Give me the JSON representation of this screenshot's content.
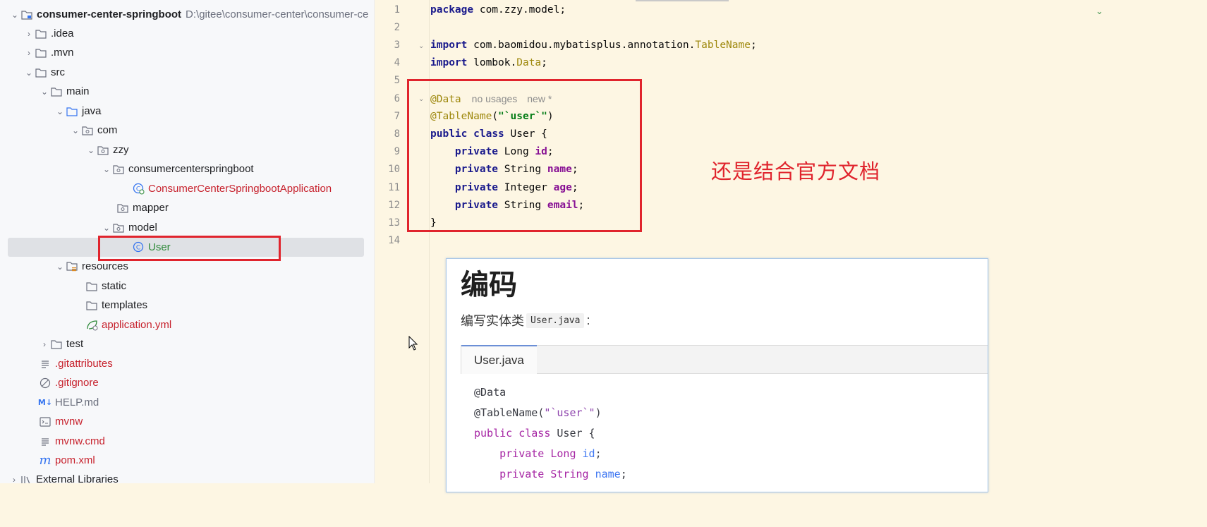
{
  "project_tree": {
    "root": {
      "name": "consumer-center-springboot",
      "path": "D:\\gitee\\consumer-center\\consumer-ce"
    },
    "items": [
      {
        "label": ".idea",
        "icon": "folder-icon"
      },
      {
        "label": ".mvn",
        "icon": "folder-icon"
      },
      {
        "label": "src",
        "icon": "folder-icon"
      },
      {
        "label": "main",
        "icon": "folder-icon"
      },
      {
        "label": "java",
        "icon": "source-folder-icon"
      },
      {
        "label": "com",
        "icon": "package-icon"
      },
      {
        "label": "zzy",
        "icon": "package-icon"
      },
      {
        "label": "consumercenterspringboot",
        "icon": "package-icon"
      },
      {
        "label": "ConsumerCenterSpringbootApplication",
        "icon": "spring-class-icon"
      },
      {
        "label": "mapper",
        "icon": "package-icon"
      },
      {
        "label": "model",
        "icon": "package-icon"
      },
      {
        "label": "User",
        "icon": "class-icon"
      },
      {
        "label": "resources",
        "icon": "resources-folder-icon"
      },
      {
        "label": "static",
        "icon": "folder-icon"
      },
      {
        "label": "templates",
        "icon": "folder-icon"
      },
      {
        "label": "application.yml",
        "icon": "spring-config-icon"
      },
      {
        "label": "test",
        "icon": "folder-icon"
      },
      {
        "label": ".gitattributes",
        "icon": "text-file-icon"
      },
      {
        "label": ".gitignore",
        "icon": "ignore-file-icon"
      },
      {
        "label": "HELP.md",
        "icon": "markdown-icon"
      },
      {
        "label": "mvnw",
        "icon": "shell-icon"
      },
      {
        "label": "mvnw.cmd",
        "icon": "text-file-icon"
      },
      {
        "label": "pom.xml",
        "icon": "maven-icon"
      },
      {
        "label": "External Libraries",
        "icon": "library-icon"
      }
    ]
  },
  "editor": {
    "line_numbers": [
      "1",
      "2",
      "3",
      "4",
      "5",
      "6",
      "7",
      "8",
      "9",
      "10",
      "11",
      "12",
      "13",
      "14"
    ],
    "tokens": {
      "package_kw": "package",
      "package_name": " com.zzy.model;",
      "import_kw": "import",
      "import1_path": " com.baomidou.mybatisplus.annotation.",
      "import1_class": "TableName",
      "semicolon": ";",
      "import2_path": " lombok.",
      "import2_class": "Data",
      "ann_data": "@Data",
      "hint_usages": "no usages",
      "hint_new": "new *",
      "ann_tablename": "@TableName",
      "paren_open": "(",
      "tablename_value": "\"`user`\"",
      "paren_close": ")",
      "public_kw": "public",
      "class_kw": "class",
      "class_decl": " User {",
      "private_kw": "private",
      "type_long": "Long",
      "type_string": "String",
      "type_integer": "Integer",
      "field_id": "id",
      "field_name": "name",
      "field_age": "age",
      "field_email": "email",
      "close_brace": "}"
    }
  },
  "annotation_note": "还是结合官方文档",
  "doc_popup": {
    "heading": "编码",
    "intro_text": "编写实体类",
    "intro_code": "User.java",
    "intro_suffix": ":",
    "tab_label": "User.java",
    "code": {
      "ann_data": "@Data",
      "ann_tablename": "@TableName",
      "paren_open": "(",
      "tablename_value": "\"`user`\"",
      "paren_close": ")",
      "public_class": "public class",
      "class_decl": " User {",
      "private_kw": "private",
      "type_long": "Long",
      "type_string": "String",
      "field_id": "id",
      "field_name": "name",
      "semicolon": ";"
    }
  },
  "colors": {
    "highlight_red": "#e0242d",
    "editor_bg": "#fdf6e3",
    "tree_bg": "#f7f8fa"
  }
}
